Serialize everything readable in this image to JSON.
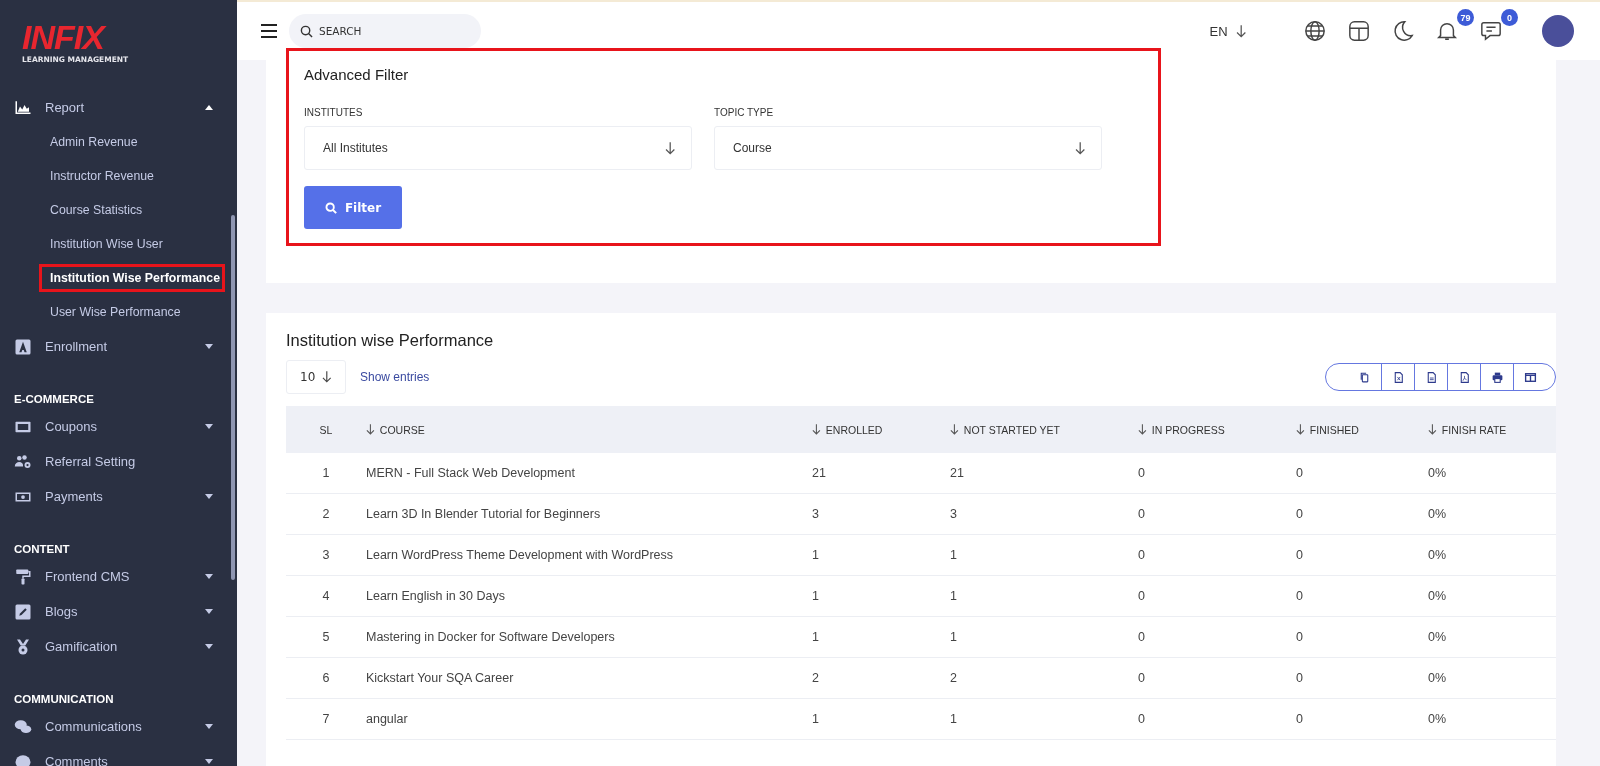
{
  "logo": {
    "brand": "INFIX",
    "tagline": "LEARNING MANAGEMENT"
  },
  "sidebar": {
    "items": [
      {
        "kind": "group",
        "label": "Report",
        "expanded": true,
        "children": [
          {
            "label": "Admin Revenue",
            "selected": false,
            "highlighted": false
          },
          {
            "label": "Instructor Revenue",
            "selected": false,
            "highlighted": false
          },
          {
            "label": "Course Statistics",
            "selected": false,
            "highlighted": false
          },
          {
            "label": "Institution Wise User",
            "selected": false,
            "highlighted": false
          },
          {
            "label": "Institution Wise Performance",
            "selected": true,
            "highlighted": true
          },
          {
            "label": "User Wise Performance",
            "selected": false,
            "highlighted": false
          }
        ]
      },
      {
        "kind": "group",
        "label": "Enrollment",
        "expanded": false
      },
      {
        "kind": "heading",
        "label": "E-COMMERCE"
      },
      {
        "kind": "group",
        "label": "Coupons",
        "expanded": false
      },
      {
        "kind": "link",
        "label": "Referral Setting"
      },
      {
        "kind": "group",
        "label": "Payments",
        "expanded": false
      },
      {
        "kind": "heading",
        "label": "CONTENT"
      },
      {
        "kind": "group",
        "label": "Frontend CMS",
        "expanded": false
      },
      {
        "kind": "group",
        "label": "Blogs",
        "expanded": false
      },
      {
        "kind": "group",
        "label": "Gamification",
        "expanded": false
      },
      {
        "kind": "heading",
        "label": "COMMUNICATION"
      },
      {
        "kind": "group",
        "label": "Communications",
        "expanded": false
      },
      {
        "kind": "group",
        "label": "Comments",
        "expanded": false
      }
    ]
  },
  "header": {
    "search": {
      "placeholder": "SEARCH"
    },
    "language": "EN",
    "notifications": "79",
    "messages": "0"
  },
  "filter": {
    "title": "Advanced Filter",
    "highlighted": true,
    "fields": [
      {
        "label": "INSTITUTES",
        "value": "All Institutes"
      },
      {
        "label": "TOPIC TYPE",
        "value": "Course"
      }
    ],
    "button": "Filter"
  },
  "table": {
    "title": "Institution wise Performance",
    "page_size": "10",
    "show_entries": "Show entries",
    "columns": [
      {
        "label": "SL",
        "sortable": false
      },
      {
        "label": "COURSE",
        "sortable": true
      },
      {
        "label": "ENROLLED",
        "sortable": true
      },
      {
        "label": "NOT STARTED YET",
        "sortable": true
      },
      {
        "label": "IN PROGRESS",
        "sortable": true
      },
      {
        "label": "FINISHED",
        "sortable": true
      },
      {
        "label": "FINISH RATE",
        "sortable": true
      }
    ],
    "rows": [
      [
        "1",
        "MERN - Full Stack Web Development",
        "21",
        "21",
        "0",
        "0",
        "0%"
      ],
      [
        "2",
        "Learn 3D In Blender Tutorial for Beginners",
        "3",
        "3",
        "0",
        "0",
        "0%"
      ],
      [
        "3",
        "Learn WordPress Theme Development with WordPress",
        "1",
        "1",
        "0",
        "0",
        "0%"
      ],
      [
        "4",
        "Learn English in 30 Days",
        "1",
        "1",
        "0",
        "0",
        "0%"
      ],
      [
        "5",
        "Mastering in Docker for Software Developers",
        "1",
        "1",
        "0",
        "0",
        "0%"
      ],
      [
        "6",
        "Kickstart Your SQA Career",
        "2",
        "2",
        "0",
        "0",
        "0%"
      ],
      [
        "7",
        "angular",
        "1",
        "1",
        "0",
        "0",
        "0%"
      ]
    ]
  }
}
